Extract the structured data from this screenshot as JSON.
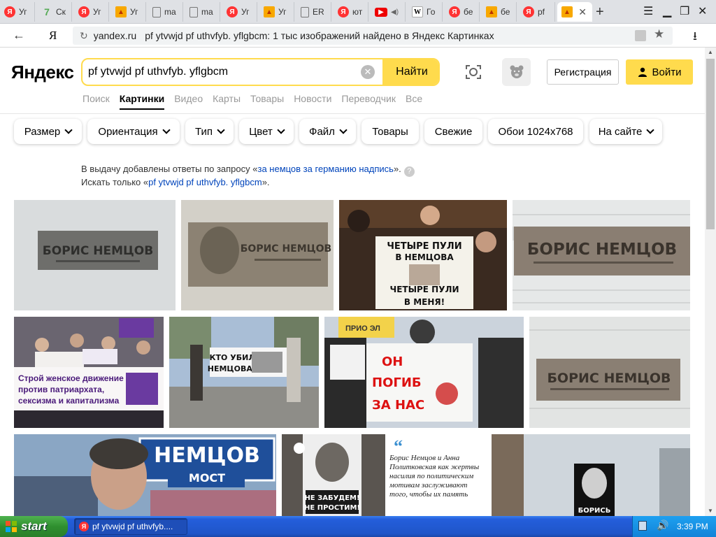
{
  "browser": {
    "tabs": [
      {
        "icon": "yandex-icon",
        "label": "Уг"
      },
      {
        "icon": "seven-icon",
        "label": "Ск"
      },
      {
        "icon": "yandex-icon",
        "label": "Уг"
      },
      {
        "icon": "images-icon",
        "label": "Уг"
      },
      {
        "icon": "document-icon",
        "label": "ma"
      },
      {
        "icon": "document-icon",
        "label": "ma"
      },
      {
        "icon": "yandex-icon",
        "label": "Уг"
      },
      {
        "icon": "images-icon",
        "label": "Уг"
      },
      {
        "icon": "document-icon",
        "label": "ER"
      },
      {
        "icon": "yandex-icon",
        "label": "ют"
      },
      {
        "icon": "youtube-icon",
        "label": ""
      },
      {
        "icon": "wikipedia-icon",
        "label": "Го"
      },
      {
        "icon": "yandex-icon",
        "label": "бе"
      },
      {
        "icon": "images-icon",
        "label": "бе"
      },
      {
        "icon": "yandex-icon",
        "label": "pf"
      },
      {
        "icon": "images-icon",
        "label": ""
      }
    ],
    "address": {
      "domain": "yandex.ru",
      "page_title": "pf ytvwjd pf uthvfyb. yflgbcm: 1 тыс изображений найдено в Яндекс Картинках"
    }
  },
  "header": {
    "logo": "Яндекс",
    "search_value": "pf ytvwjd pf uthvfyb. yflgbcm",
    "search_button": "Найти",
    "register_button": "Регистрация",
    "login_button": "Войти"
  },
  "services": [
    "Поиск",
    "Картинки",
    "Видео",
    "Карты",
    "Товары",
    "Новости",
    "Переводчик",
    "Все"
  ],
  "filters": [
    "Размер",
    "Ориентация",
    "Тип",
    "Цвет",
    "Файл",
    "Товары",
    "Свежие",
    "Обои 1024x768",
    "На сайте"
  ],
  "notice": {
    "line1_prefix": "В выдачу добавлены ответы по запросу «",
    "line1_link": "за немцов за германию надпись",
    "line1_suffix": "».",
    "line2_prefix": "Искать только «",
    "line2_link": "pf ytvwjd pf uthvfyb. yflgbcm",
    "line2_suffix": "»."
  },
  "images": {
    "img1": "БОРИС НЕМЦОВ",
    "img2": "БОРИС НЕМЦОВ",
    "img3_top": "ЧЕТЫРЕ ПУЛИ",
    "img3_mid": "В НЕМЦОВА",
    "img3_low": "ЧЕТЫРЕ ПУЛИ",
    "img3_bottom": "В МЕНЯ!",
    "img4": "БОРИС НЕМЦОВ",
    "img5_line1": "Строй женское движение",
    "img5_line2": "против патриархата,",
    "img5_line3": "сексизма и капитализма",
    "img6_line1": "КТО УБИЛ",
    "img6_line2": "НЕМЦОВА?",
    "img7_top": "ПРИО ЭЛ",
    "img7_line1": "ОН",
    "img7_line2": "ПОГИБ",
    "img7_line3": "ЗА НАС",
    "img8": "БОРИС НЕМЦОВ",
    "img9_line1": "НЕМЦОВ",
    "img9_line2": "МОСТ",
    "img10_line1": "НЕ ЗАБУДЕМ!",
    "img10_line2": "НЕ ПРОСТИМ!",
    "img11_quote": "Борис Немцов и Анна Политковская как жертвы насилия по политическим мотивам заслуживают того, чтобы их память",
    "img12": "БОРИСЬ"
  },
  "taskbar": {
    "start": "start",
    "task": "pf ytvwjd pf uthvfyb....",
    "clock": "3:39 PM"
  },
  "colors": {
    "accent_yellow": "#ffdb4d",
    "logo_red": "#ff0000",
    "link_blue": "#0044bb"
  }
}
